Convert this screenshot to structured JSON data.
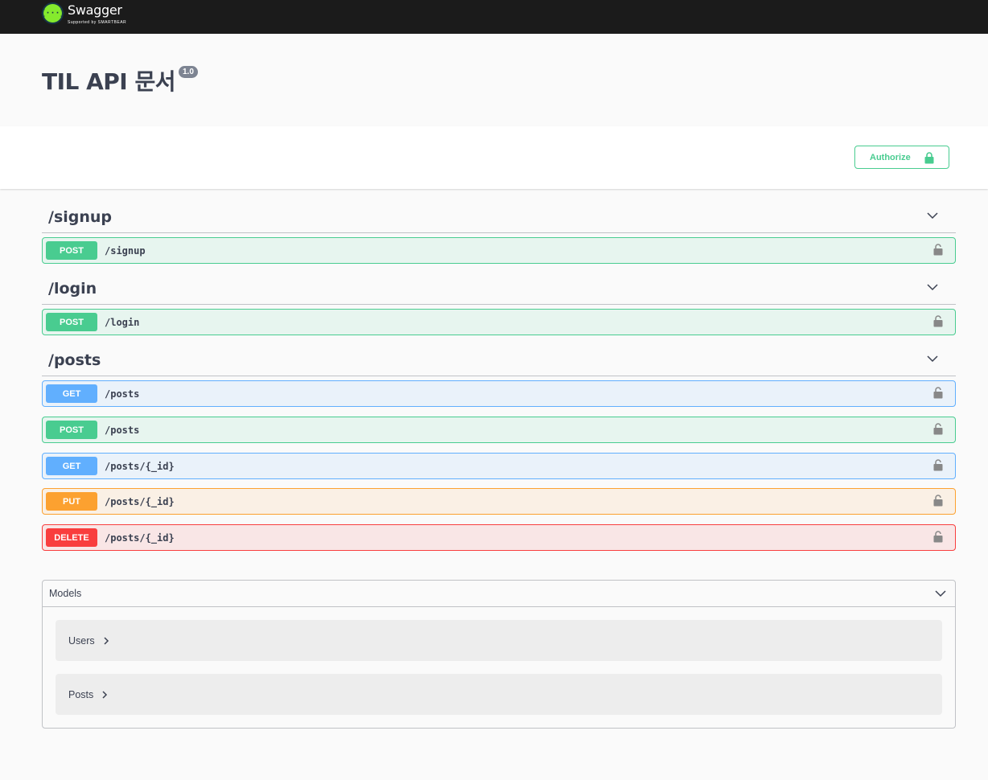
{
  "topbar": {
    "logo_mark": "{···}",
    "logo_name": "Swagger",
    "logo_sub": "Supported by SMARTBEAR",
    "colors": {
      "background": "#1b1b1b",
      "logo_green": "#85ea2d"
    }
  },
  "info": {
    "title": "TIL API 문서",
    "version": "1.0"
  },
  "scheme": {
    "authorize_label": "Authorize",
    "icon": "lock-icon"
  },
  "tags": [
    {
      "name": "/signup",
      "operations": [
        {
          "method": "POST",
          "path": "/signup"
        }
      ]
    },
    {
      "name": "/login",
      "operations": [
        {
          "method": "POST",
          "path": "/login"
        }
      ]
    },
    {
      "name": "/posts",
      "operations": [
        {
          "method": "GET",
          "path": "/posts"
        },
        {
          "method": "POST",
          "path": "/posts"
        },
        {
          "method": "GET",
          "path": "/posts/{_id}"
        },
        {
          "method": "PUT",
          "path": "/posts/{_id}"
        },
        {
          "method": "DELETE",
          "path": "/posts/{_id}"
        }
      ]
    }
  ],
  "models": {
    "title": "Models",
    "items": [
      {
        "name": "Users"
      },
      {
        "name": "Posts"
      }
    ]
  },
  "method_colors": {
    "GET": "#61affe",
    "POST": "#49cc90",
    "PUT": "#fca130",
    "DELETE": "#f93e3e"
  }
}
